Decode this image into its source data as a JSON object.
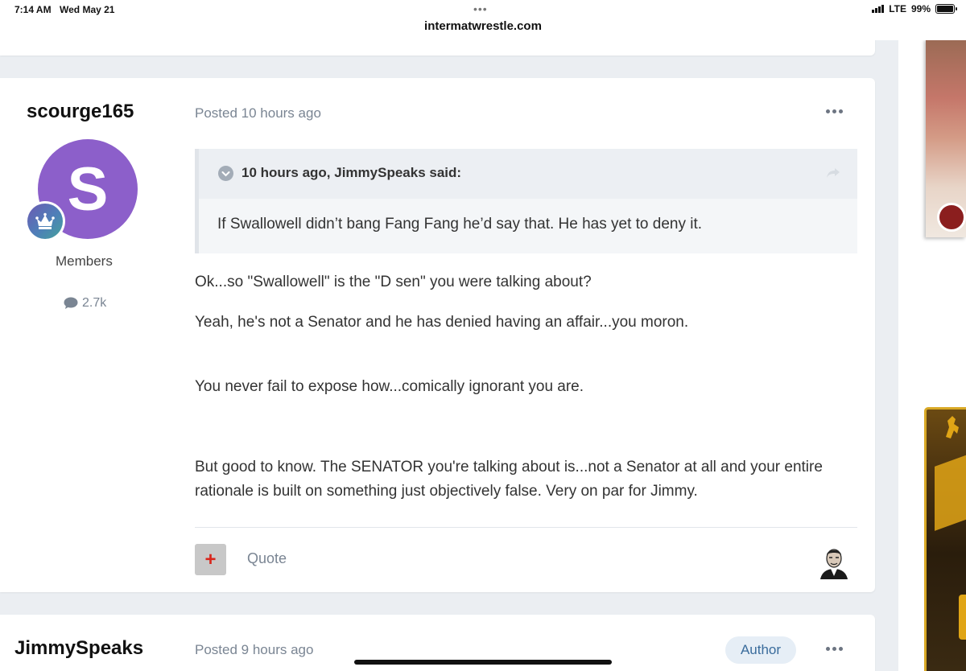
{
  "status_bar": {
    "time": "7:14 AM",
    "date": "Wed May 21",
    "url": "intermatwrestle.com",
    "network": "LTE",
    "battery": "99%",
    "battery_level": 0.99
  },
  "post": {
    "author": "scourge165",
    "avatar_letter": "S",
    "avatar_color": "#8c5fca",
    "group": "Members",
    "content_count": "2.7k",
    "posted": "Posted 10 hours ago",
    "quote": {
      "citation": "10 hours ago, JimmySpeaks said:",
      "text": "If Swallowell didn’t bang Fang Fang he’d say that.  He has yet to deny it."
    },
    "paragraphs": [
      "Ok...so \"Swallowell\" is the \"D sen\" you were talking about?",
      "Yeah, he's not a Senator and he has denied having an affair...you moron.",
      "You never fail to expose how...comically ignorant you are.",
      "But good to know. The SENATOR you're talking about is...not a Senator at all and your entire rationale is built on something just objectively false. Very on par for Jimmy."
    ],
    "quote_button": "Quote"
  },
  "next_post": {
    "author": "JimmySpeaks",
    "posted": "Posted 9 hours ago",
    "author_badge": "Author"
  },
  "icons": {
    "more": "more-options-icon",
    "chevron": "collapse-chevron-icon",
    "share": "share-arrow-icon",
    "comment": "comment-bubble-icon",
    "reputation": "plus-icon"
  }
}
